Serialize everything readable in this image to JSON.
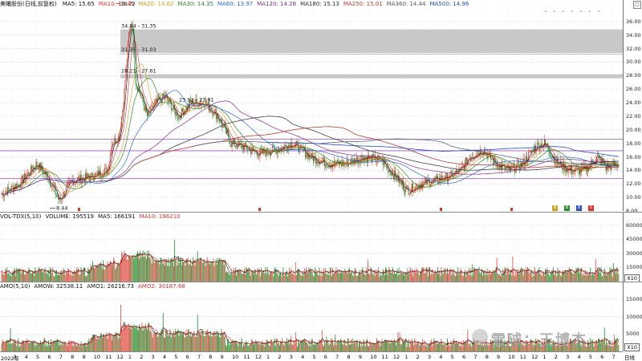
{
  "main": {
    "title": "美曦股份(日线,前复权)",
    "indicators": [
      {
        "label": "MA5: 15.65",
        "color": "#111111"
      },
      {
        "label": "MA10: 15.45",
        "color": "#e0302a"
      },
      {
        "label": "MA20: 14.62",
        "color": "#d4a017"
      },
      {
        "label": "MA30: 14.35",
        "color": "#2a8a2a"
      },
      {
        "label": "MA60: 13.97",
        "color": "#2a6adf"
      },
      {
        "label": "MA120: 14.28",
        "color": "#8a2a8a"
      },
      {
        "label": "MA180: 15.13",
        "color": "#2a2a2a"
      },
      {
        "label": "MA250: 15.01",
        "color": "#c0392b"
      },
      {
        "label": "MA360: 14.44",
        "color": "#555555"
      },
      {
        "label": "MA500: 14.96",
        "color": "#1f4fbf"
      }
    ],
    "y_ticks": [
      "36.00",
      "34.00",
      "32.00",
      "30.00",
      "28.00",
      "26.00",
      "24.00",
      "22.00",
      "20.00",
      "18.00",
      "16.00",
      "14.00",
      "12.00",
      "10.00",
      "8.00"
    ],
    "annotations": {
      "high": "38.72",
      "low": "8.44",
      "zone1": "34.84 - 31.35",
      "zone2": "31.35 - 31.03",
      "zone3": "28.21 - 27.61",
      "zone4": "23.92 - 23.81"
    },
    "markers": [
      {
        "letter": "B",
        "color": "#c9a227"
      },
      {
        "letter": "B",
        "color": "#2e8b2e"
      },
      {
        "letter": "B",
        "color": "#2b4fbf"
      },
      {
        "letter": "S",
        "color": "#d9342b"
      }
    ]
  },
  "volume": {
    "indicators": [
      {
        "label": "VOL-TDX(5,10)",
        "color": "#111111"
      },
      {
        "label": "VOLUME: 195519",
        "color": "#111111"
      },
      {
        "label": "MA5: 166191",
        "color": "#111111"
      },
      {
        "label": "MA10: 196210",
        "color": "#e0302a"
      }
    ],
    "y_ticks": [
      "60000",
      "45000",
      "30000",
      "15000"
    ],
    "unit": "X10"
  },
  "amount": {
    "indicators": [
      {
        "label": "AMO(5,10)",
        "color": "#111111"
      },
      {
        "label": "AMOW: 32538.11",
        "color": "#111111"
      },
      {
        "label": "AMO1: 26216.73",
        "color": "#111111"
      },
      {
        "label": "AMO2: 30187.68",
        "color": "#e0302a"
      }
    ],
    "y_ticks": [
      "15000",
      "10000",
      "5000"
    ],
    "unit": "X10"
  },
  "x_axis": {
    "labels": [
      "2022年",
      "3",
      "4",
      "5",
      "6",
      "7",
      "8",
      "9",
      "10",
      "11",
      "12",
      "1",
      "2",
      "3",
      "4",
      "5",
      "6",
      "7",
      "8",
      "9",
      "10",
      "11",
      "12",
      "1",
      "2",
      "3",
      "4",
      "5",
      "6",
      "7",
      "8",
      "9",
      "10",
      "11",
      "12",
      "1",
      "2",
      "3",
      "4",
      "5",
      "6",
      "7",
      "8",
      "9",
      "10",
      "11",
      "12",
      "1",
      "2",
      "3",
      "4",
      "5",
      "6",
      "7"
    ],
    "end_label": "日线"
  },
  "watermark": "雪球：王博杰",
  "corner_button": "□"
}
